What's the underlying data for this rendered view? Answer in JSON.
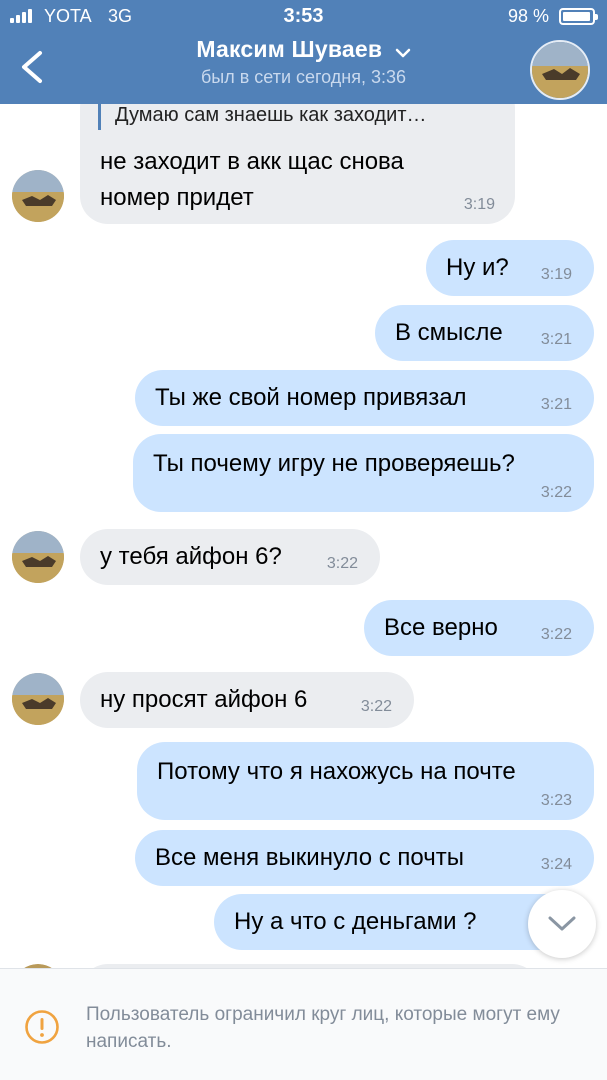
{
  "status_bar": {
    "carrier": "YOTA",
    "network": "3G",
    "time": "3:53",
    "battery_text": "98 %",
    "battery_level": 0.98
  },
  "header": {
    "contact_name": "Максим Шуваев",
    "last_seen": "был в сети сегодня, 3:36"
  },
  "messages": [
    {
      "from": "them",
      "quote": "Думаю сам знаешь как заходит…",
      "text": "не заходит в акк щас снова\nномер придет",
      "time": "3:19"
    },
    {
      "from": "me",
      "text": "Ну и?",
      "time": "3:19"
    },
    {
      "from": "me",
      "text": "В смысле",
      "time": "3:21"
    },
    {
      "from": "me",
      "text": "Ты же свой номер привязал",
      "time": "3:21"
    },
    {
      "from": "me",
      "text": "Ты почему игру не проверяешь?",
      "time": "3:22"
    },
    {
      "from": "them",
      "text": "у тебя айфон 6?",
      "time": "3:22"
    },
    {
      "from": "me",
      "text": "Все верно",
      "time": "3:22"
    },
    {
      "from": "them",
      "text": "ну просят айфон 6",
      "time": "3:22"
    },
    {
      "from": "me",
      "text": "Потому что я нахожусь на почте",
      "time": "3:23"
    },
    {
      "from": "me",
      "text": "Все меня выкинуло с почты",
      "time": "3:24"
    },
    {
      "from": "me",
      "text": "Ну а что с деньгами ?",
      "time": ""
    }
  ],
  "notice": {
    "text": "Пользователь ограничил круг лиц, которые могут ему написать."
  },
  "colors": {
    "header": "#5181b8",
    "incoming_bubble": "#ebedf0",
    "outgoing_bubble": "#cce4ff",
    "time": "#828c99",
    "notice_icon": "#f0a340"
  },
  "icons": {
    "back": "chevron-left-icon",
    "title_dropdown": "chevron-down-icon",
    "scroll_down": "chevron-down-icon",
    "notice": "warning-circle-icon"
  }
}
